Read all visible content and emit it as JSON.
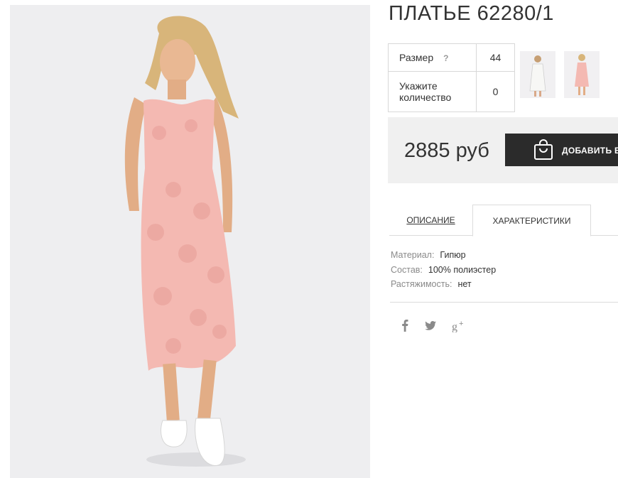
{
  "product": {
    "title": "ПЛАТЬЕ 62280/1",
    "price": "2885 руб",
    "buy_label": "ДОБАВИТЬ В"
  },
  "options": {
    "size_label": "Размер",
    "size_help": "?",
    "size_value": "44",
    "qty_label_line1": "Укажите",
    "qty_label_line2": "количество",
    "qty_value": "0"
  },
  "tabs": [
    {
      "label": "ОПИСАНИЕ"
    },
    {
      "label": "ХАРАКТЕРИСТИКИ"
    }
  ],
  "specs": [
    {
      "key": "Материал:",
      "value": "Гипюр"
    },
    {
      "key": "Состав:",
      "value": "100% полиэстер"
    },
    {
      "key": "Растяжимость:",
      "value": "нет"
    }
  ],
  "social": {
    "facebook": "f",
    "twitter": "twitter-bird",
    "gplus": "g+"
  },
  "colors": {
    "dress": "#f4b9b2",
    "button_bg": "#2b2b2b",
    "panel_bg": "#f0f0f0",
    "photo_bg": "#eeeef0"
  }
}
